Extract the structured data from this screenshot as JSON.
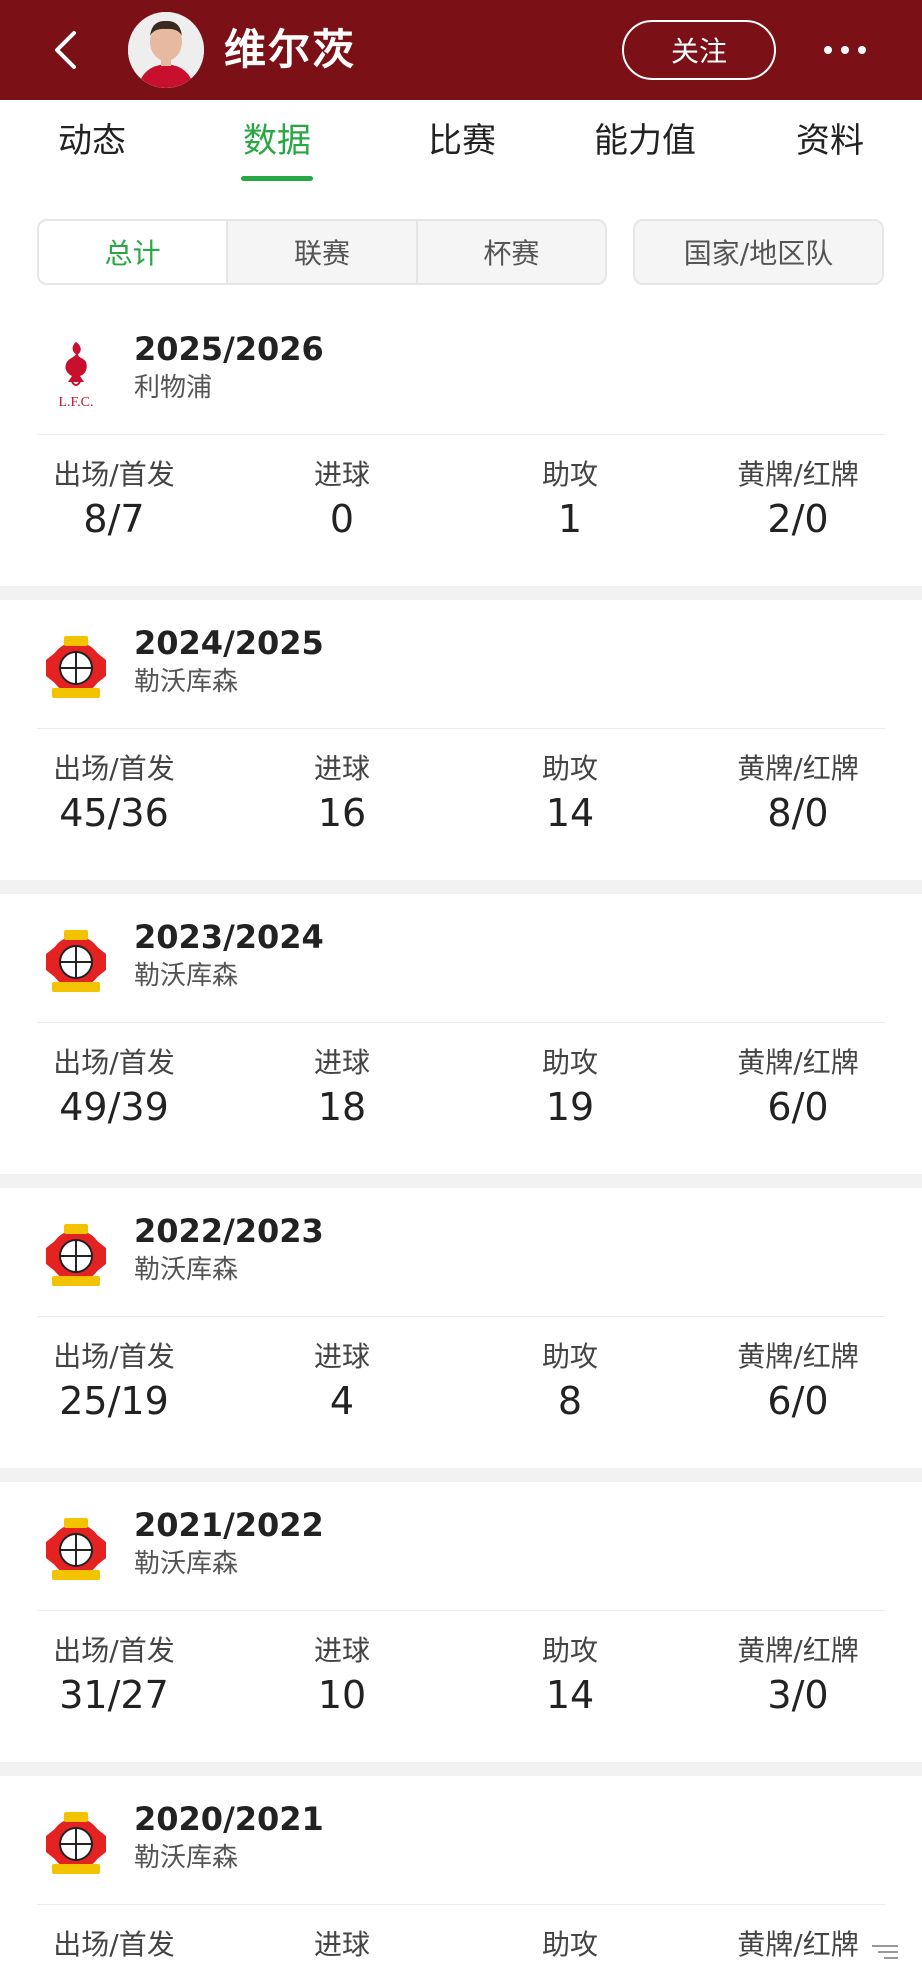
{
  "header": {
    "player_name": "维尔茨",
    "follow_label": "关注",
    "bg_color": "#7b1117"
  },
  "tabs": [
    "动态",
    "数据",
    "比赛",
    "能力值",
    "资料"
  ],
  "active_tab": "数据",
  "filters": {
    "segments": [
      "总计",
      "联赛",
      "杯赛"
    ],
    "active": "总计",
    "national": "国家/地区队"
  },
  "stat_labels": {
    "apps": "出场/首发",
    "goals": "进球",
    "assists": "助攻",
    "cards": "黄牌/红牌"
  },
  "seasons": [
    {
      "year": "2025/2026",
      "club": "利物浦",
      "logo": "liverpool-logo",
      "apps": "8/7",
      "goals": "0",
      "assists": "1",
      "cards": "2/0"
    },
    {
      "year": "2024/2025",
      "club": "勒沃库森",
      "logo": "leverkusen-logo",
      "apps": "45/36",
      "goals": "16",
      "assists": "14",
      "cards": "8/0"
    },
    {
      "year": "2023/2024",
      "club": "勒沃库森",
      "logo": "leverkusen-logo",
      "apps": "49/39",
      "goals": "18",
      "assists": "19",
      "cards": "6/0"
    },
    {
      "year": "2022/2023",
      "club": "勒沃库森",
      "logo": "leverkusen-logo",
      "apps": "25/19",
      "goals": "4",
      "assists": "8",
      "cards": "6/0"
    },
    {
      "year": "2021/2022",
      "club": "勒沃库森",
      "logo": "leverkusen-logo",
      "apps": "31/27",
      "goals": "10",
      "assists": "14",
      "cards": "3/0"
    },
    {
      "year": "2020/2021",
      "club": "勒沃库森",
      "logo": "leverkusen-logo",
      "apps": "",
      "goals": "",
      "assists": "",
      "cards": ""
    }
  ],
  "colors": {
    "accent": "#28a745",
    "liverpool_red": "#c8102e",
    "leverkusen_red": "#e32221",
    "leverkusen_yellow": "#f3c300"
  }
}
